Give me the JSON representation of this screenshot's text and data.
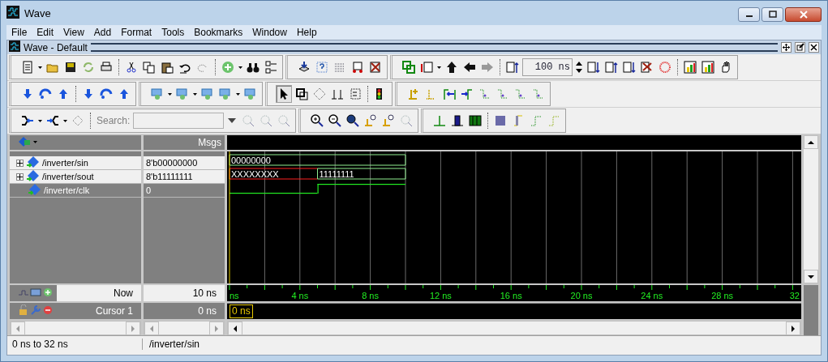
{
  "window": {
    "title": "Wave"
  },
  "menu": [
    "File",
    "Edit",
    "View",
    "Add",
    "Format",
    "Tools",
    "Bookmarks",
    "Window",
    "Help"
  ],
  "subwindow": {
    "title": "Wave - Default"
  },
  "toolbar": {
    "time_step": "100 ns",
    "search_label": "Search:",
    "pointer_mode": true
  },
  "wave": {
    "header_msgs": "Msgs",
    "signals": [
      {
        "name": "/inverter/sin",
        "value": "8'b00000000",
        "kind": "bus",
        "expandable": true,
        "selected": false,
        "segments": [
          {
            "label": "00000000",
            "unknown": false
          }
        ]
      },
      {
        "name": "/inverter/sout",
        "value": "8'b11111111",
        "kind": "bus",
        "expandable": true,
        "selected": false,
        "segments": [
          {
            "label": "XXXXXXXX",
            "unknown": true
          },
          {
            "label": "11111111",
            "unknown": false
          }
        ]
      },
      {
        "name": "/inverter/clk",
        "value": "0",
        "kind": "bit",
        "expandable": false,
        "selected": true,
        "segments": [
          {
            "high": false
          },
          {
            "high": true
          }
        ]
      }
    ],
    "now": {
      "label": "Now",
      "value": "10 ns"
    },
    "cursor": {
      "label": "Cursor 1",
      "value": "0 ns",
      "marker": "0 ns"
    },
    "ruler": [
      "ns",
      "4 ns",
      "8 ns",
      "12 ns",
      "16 ns",
      "20 ns",
      "24 ns",
      "28 ns",
      "32"
    ]
  },
  "status_bar": {
    "range": "0 ns to 32 ns",
    "selection": "/inverter/sin"
  }
}
